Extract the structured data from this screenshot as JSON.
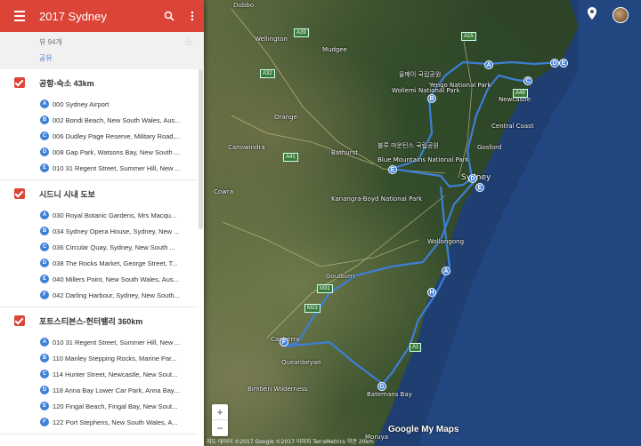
{
  "header": {
    "title": "2017 Sydney",
    "menu_icon": "hamburger-icon",
    "search_icon": "search-icon",
    "more_icon": "more-vert-icon"
  },
  "info": {
    "views": "뷰 94개",
    "share": "공유"
  },
  "layers": [
    {
      "title": "공항-숙소 43km",
      "items": [
        {
          "badge": "A",
          "text": "000 Sydney Airport"
        },
        {
          "badge": "B",
          "text": "002 Bondi Beach, New South Wales, Aus..."
        },
        {
          "badge": "C",
          "text": "006 Dudley Page Reserve, Military Road,..."
        },
        {
          "badge": "D",
          "text": "008 Gap Park, Watsons Bay, New South ..."
        },
        {
          "badge": "E",
          "text": "010 31 Regent Street, Summer Hill, New ..."
        }
      ]
    },
    {
      "title": "시드니 시내 도보",
      "items": [
        {
          "badge": "A",
          "text": "030 Royal Botanic Gardens, Mrs Macqu..."
        },
        {
          "badge": "B",
          "text": "034 Sydney Opera House, Sydney, New ..."
        },
        {
          "badge": "C",
          "text": "036 Circular Quay, Sydney, New South ..."
        },
        {
          "badge": "D",
          "text": "038 The Rocks Market, George Street, T..."
        },
        {
          "badge": "E",
          "text": "040 Millers Point, New South Wales, Aus..."
        },
        {
          "badge": "F",
          "text": "042 Darling Harbour, Sydney, New South..."
        }
      ]
    },
    {
      "title": "포트스티븐스-헌터밸리 360km",
      "items": [
        {
          "badge": "A",
          "text": "010 31 Regent Street, Summer Hill, New ..."
        },
        {
          "badge": "B",
          "text": "110 Manley Stepping Rocks, Marine Par..."
        },
        {
          "badge": "C",
          "text": "114 Hunter Street, Newcastle, New Sout..."
        },
        {
          "badge": "D",
          "text": "118 Anna Bay Lower Car Park, Anna Bay..."
        },
        {
          "badge": "E",
          "text": "120 Fingal Beach, Fingal Bay, New Sout..."
        },
        {
          "badge": "F",
          "text": "122 Port Stephens, New South Wales, A..."
        }
      ]
    }
  ],
  "map": {
    "places": [
      "Dubbo",
      "Wellington",
      "Mudgee",
      "울메이 국립공원",
      "Wollemi National Park",
      "Orange",
      "Bathurst",
      "Canowindra",
      "Cowra",
      "블루 마운틴스 국립공원",
      "Blue Mountains National Park",
      "Sydney",
      "Kanangra-Boyd National Park",
      "Wollongong",
      "Goulburn",
      "Canberra",
      "Queanbeyan",
      "Bimberi Wilderness",
      "Batemans Bay",
      "Moruya",
      "Central Coast",
      "Gosford",
      "Newcastle",
      "Yengo National Park"
    ],
    "highways": [
      "A32",
      "A39",
      "A41",
      "M31",
      "M23",
      "A1",
      "A49",
      "A15"
    ],
    "route_color": "#3e7fd6",
    "markers": [
      "A",
      "B",
      "C",
      "D",
      "E",
      "F",
      "G",
      "H"
    ]
  },
  "controls": {
    "zoom_in": "+",
    "zoom_out": "−",
    "logo": "Google My Maps",
    "attribution": "지도 데이터 ©2017 Google ©2017 이미지 TerraMetrics   약관   20km"
  }
}
